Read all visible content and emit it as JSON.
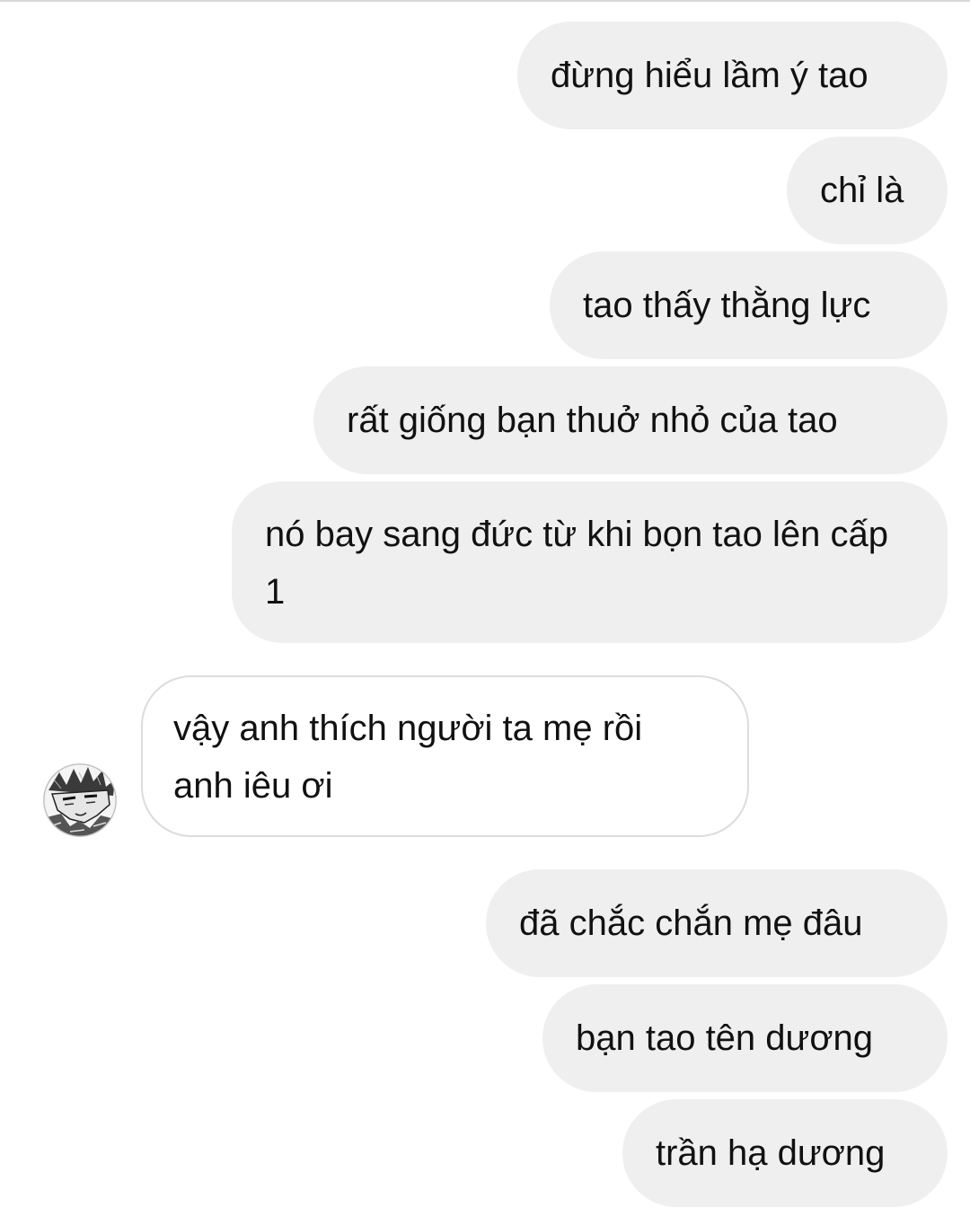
{
  "messages": [
    {
      "id": "m1",
      "direction": "sent",
      "text": "đừng hiểu lầm ý tao"
    },
    {
      "id": "m2",
      "direction": "sent",
      "text": "chỉ là"
    },
    {
      "id": "m3",
      "direction": "sent",
      "text": "tao thấy thằng lực"
    },
    {
      "id": "m4",
      "direction": "sent",
      "text": "rất giống bạn thuở nhỏ của tao"
    },
    {
      "id": "m5",
      "direction": "sent",
      "text": "nó bay sang đức từ khi bọn tao lên cấp 1"
    },
    {
      "id": "m6",
      "direction": "received",
      "text": "vậy anh thích người ta mẹ rồi anh iêu ơi"
    },
    {
      "id": "m7",
      "direction": "sent",
      "text": "đã chắc chắn mẹ đâu"
    },
    {
      "id": "m8",
      "direction": "sent",
      "text": "bạn tao tên dương"
    },
    {
      "id": "m9",
      "direction": "sent",
      "text": "trần hạ dương"
    }
  ],
  "colors": {
    "sent_bubble": "#efefef",
    "received_border": "#dcdcdc",
    "text": "#111111",
    "background": "#ffffff"
  },
  "avatar": {
    "icon": "manga-avatar-icon"
  }
}
